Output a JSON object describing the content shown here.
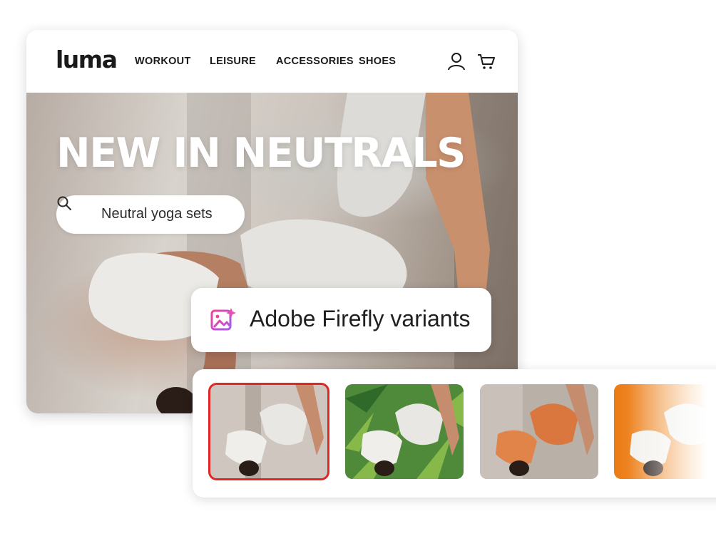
{
  "nav": {
    "logo": "luma",
    "items": [
      {
        "label": "WORKOUT"
      },
      {
        "label": "LEISURE"
      },
      {
        "label": "ACCESSORIES"
      },
      {
        "label": "SHOES"
      }
    ],
    "icons": [
      "user-icon",
      "cart-icon"
    ]
  },
  "hero": {
    "headline": "NEW IN NEUTRALS",
    "search": {
      "icon": "search-icon",
      "query": "Neutral yoga sets"
    }
  },
  "firefly": {
    "icon": "firefly-image-icon",
    "label": "Adobe Firefly variants",
    "variants": [
      {
        "background": "neutral-wall",
        "selected": true,
        "accent": "#e02626"
      },
      {
        "background": "palm-leaves",
        "selected": false
      },
      {
        "background": "orange-outfit",
        "selected": false
      },
      {
        "background": "orange-gradient",
        "selected": false
      }
    ]
  }
}
